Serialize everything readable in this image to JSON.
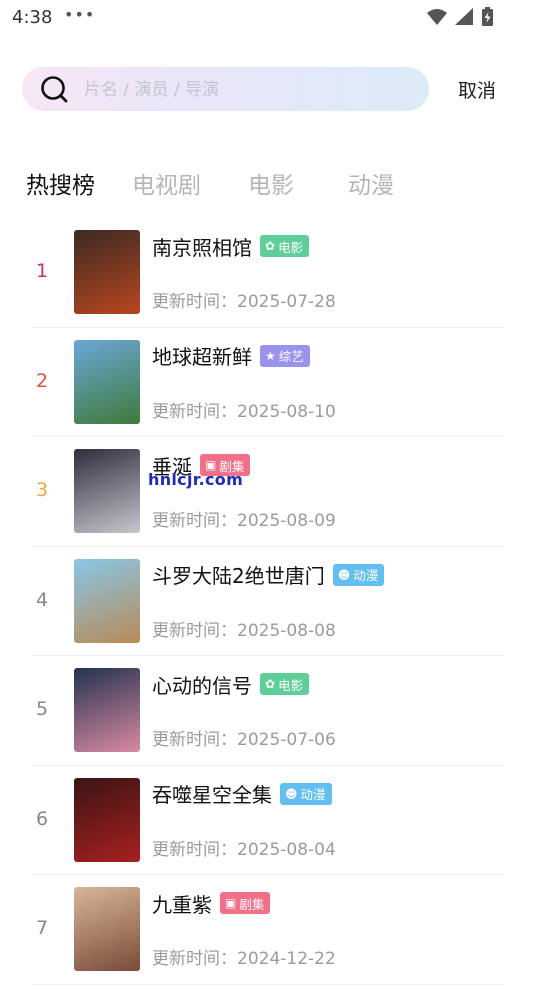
{
  "status_bar": {
    "time": "4:38",
    "dots": "•••"
  },
  "search": {
    "placeholder": "片名 / 演员 / 导演",
    "value": "",
    "cancel_label": "取消"
  },
  "tabs": [
    {
      "label": "热搜榜",
      "active": true
    },
    {
      "label": "电视剧",
      "active": false
    },
    {
      "label": "电影",
      "active": false
    },
    {
      "label": "动漫",
      "active": false
    }
  ],
  "date_prefix": "更新时间：",
  "items": [
    {
      "rank": "1",
      "rank_color": "#c2317a",
      "title": "南京照相馆",
      "badge": {
        "label": "电影",
        "icon": "film-reel-icon",
        "color": "#5fcf99"
      },
      "date": "2025-07-28",
      "poster_colors": [
        "#3b2a22",
        "#b8461f"
      ]
    },
    {
      "rank": "2",
      "rank_color": "#e0513f",
      "title": "地球超新鲜",
      "badge": {
        "label": "综艺",
        "icon": "star-icon",
        "color": "#9a93ee"
      },
      "date": "2025-08-10",
      "poster_colors": [
        "#6aa7d8",
        "#3f7a3a"
      ]
    },
    {
      "rank": "3",
      "rank_color": "#f0a646",
      "title": "垂涎",
      "badge": {
        "label": "剧集",
        "icon": "tv-icon",
        "color": "#ef7088"
      },
      "date": "2025-08-09",
      "poster_colors": [
        "#2e2d3c",
        "#c9c6cf"
      ]
    },
    {
      "rank": "4",
      "rank_color": "#888888",
      "title": "斗罗大陆2绝世唐门",
      "badge": {
        "label": "动漫",
        "icon": "cat-face-icon",
        "color": "#62bff0"
      },
      "date": "2025-08-08",
      "poster_colors": [
        "#88c7e8",
        "#b98a56"
      ]
    },
    {
      "rank": "5",
      "rank_color": "#888888",
      "title": "心动的信号",
      "badge": {
        "label": "电影",
        "icon": "film-reel-icon",
        "color": "#5fcf99"
      },
      "date": "2025-07-06",
      "poster_colors": [
        "#24324f",
        "#d98aa2"
      ]
    },
    {
      "rank": "6",
      "rank_color": "#888888",
      "title": "吞噬星空全集",
      "badge": {
        "label": "动漫",
        "icon": "cat-face-icon",
        "color": "#62bff0"
      },
      "date": "2025-08-04",
      "poster_colors": [
        "#3b1414",
        "#a8201f"
      ]
    },
    {
      "rank": "7",
      "rank_color": "#888888",
      "title": "九重紫",
      "badge": {
        "label": "剧集",
        "icon": "tv-icon",
        "color": "#ef7088"
      },
      "date": "2024-12-22",
      "poster_colors": [
        "#d8b69a",
        "#7a4b37"
      ]
    }
  ],
  "watermark": "hnlcjr.com"
}
